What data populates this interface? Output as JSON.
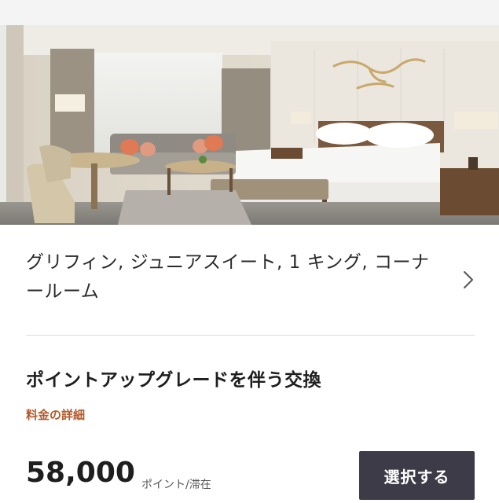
{
  "room": {
    "title": "グリフィン, ジュニアスイート, 1 キング, コーナールーム",
    "photo_alt": "hotel-room-photo",
    "chevron_icon": "chevron-right-icon"
  },
  "offer": {
    "heading": "ポイントアップグレードを伴う交換",
    "rate_details_label": "料金の詳細",
    "points_value": "58,000",
    "points_unit": "ポイント/滞在",
    "select_label": "選択する"
  },
  "colors": {
    "accent": "#b5582a",
    "button_bg": "#3d3b47",
    "text_primary": "#1e1e1e"
  }
}
